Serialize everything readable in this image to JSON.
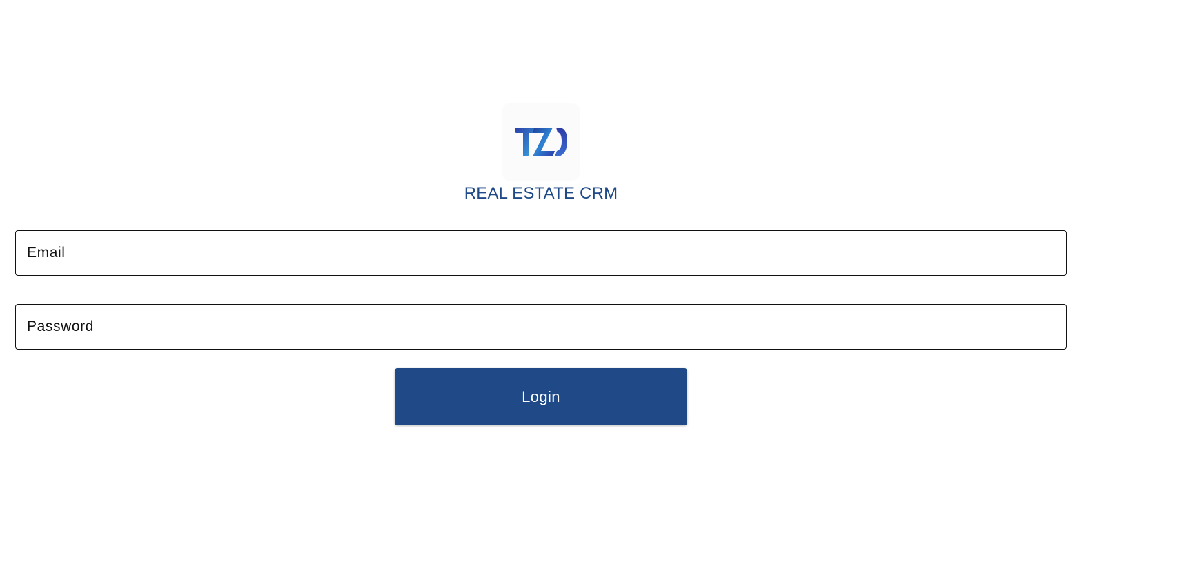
{
  "logo": {
    "icon": "tzi-logo-icon",
    "text": "TZI",
    "colors": [
      "#2a3fa8",
      "#2f7fd0",
      "#3ab3e6"
    ]
  },
  "app_title": "REAL ESTATE CRM",
  "form": {
    "email_placeholder": "Email",
    "email_value": "",
    "password_placeholder": "Password",
    "password_value": "",
    "login_label": "Login"
  },
  "colors": {
    "brand": "#1f4a87",
    "background": "#ffffff",
    "field_border": "#111111"
  }
}
